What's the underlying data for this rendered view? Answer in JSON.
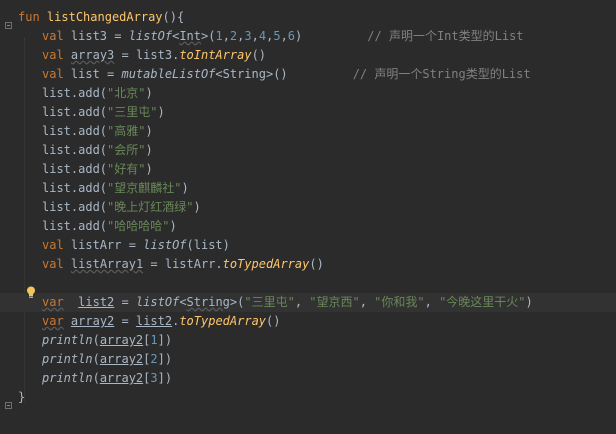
{
  "colors": {
    "background": "#2b2b2b",
    "keyword": "#cc7832",
    "function": "#ffc66d",
    "number": "#6897bb",
    "string": "#6a8759",
    "comment": "#808080",
    "text": "#a9b7c6"
  },
  "lines": [
    {
      "indent": 0,
      "tokens": [
        {
          "t": "fun",
          "c": "kw"
        },
        {
          "t": " "
        },
        {
          "t": "listChangedArray",
          "c": "fn"
        },
        {
          "t": "(){"
        }
      ]
    },
    {
      "indent": 1,
      "tokens": [
        {
          "t": "val",
          "c": "kw"
        },
        {
          "t": " list3 = "
        },
        {
          "t": "listOf",
          "c": "it"
        },
        {
          "t": "<"
        },
        {
          "t": "Int",
          "c": "und"
        },
        {
          "t": ">("
        },
        {
          "t": "1",
          "c": "num"
        },
        {
          "t": ","
        },
        {
          "t": "2",
          "c": "num"
        },
        {
          "t": ","
        },
        {
          "t": "3",
          "c": "num"
        },
        {
          "t": ","
        },
        {
          "t": "4",
          "c": "num"
        },
        {
          "t": ","
        },
        {
          "t": "5",
          "c": "num"
        },
        {
          "t": ","
        },
        {
          "t": "6",
          "c": "num"
        },
        {
          "t": ")         "
        },
        {
          "t": "// 声明一个Int类型的List",
          "c": "cmt"
        }
      ]
    },
    {
      "indent": 1,
      "tokens": [
        {
          "t": "val",
          "c": "kw"
        },
        {
          "t": " "
        },
        {
          "t": "array3",
          "c": "und"
        },
        {
          "t": " = list3."
        },
        {
          "t": "toIntArray",
          "c": "fn it"
        },
        {
          "t": "()"
        }
      ]
    },
    {
      "indent": 1,
      "tokens": [
        {
          "t": "val",
          "c": "kw"
        },
        {
          "t": " list = "
        },
        {
          "t": "mutableListOf",
          "c": "it"
        },
        {
          "t": "<String>()         "
        },
        {
          "t": "// 声明一个String类型的List",
          "c": "cmt"
        }
      ]
    },
    {
      "indent": 1,
      "tokens": [
        {
          "t": "list.add("
        },
        {
          "t": "\"北京\"",
          "c": "str"
        },
        {
          "t": ")"
        }
      ]
    },
    {
      "indent": 1,
      "tokens": [
        {
          "t": "list.add("
        },
        {
          "t": "\"三里屯\"",
          "c": "str"
        },
        {
          "t": ")"
        }
      ]
    },
    {
      "indent": 1,
      "tokens": [
        {
          "t": "list.add("
        },
        {
          "t": "\"高雅\"",
          "c": "str"
        },
        {
          "t": ")"
        }
      ]
    },
    {
      "indent": 1,
      "tokens": [
        {
          "t": "list.add("
        },
        {
          "t": "\"会所\"",
          "c": "str"
        },
        {
          "t": ")"
        }
      ]
    },
    {
      "indent": 1,
      "tokens": [
        {
          "t": "list.add("
        },
        {
          "t": "\"好有\"",
          "c": "str"
        },
        {
          "t": ")"
        }
      ]
    },
    {
      "indent": 1,
      "tokens": [
        {
          "t": "list.add("
        },
        {
          "t": "\"望京麒麟社\"",
          "c": "str"
        },
        {
          "t": ")"
        }
      ]
    },
    {
      "indent": 1,
      "tokens": [
        {
          "t": "list.add("
        },
        {
          "t": "\"晚上灯红酒绿\"",
          "c": "str"
        },
        {
          "t": ")"
        }
      ]
    },
    {
      "indent": 1,
      "tokens": [
        {
          "t": "list.add("
        },
        {
          "t": "\"哈哈哈哈\"",
          "c": "str"
        },
        {
          "t": ")"
        }
      ]
    },
    {
      "indent": 1,
      "tokens": [
        {
          "t": "val",
          "c": "kw"
        },
        {
          "t": " listArr = "
        },
        {
          "t": "listOf",
          "c": "it"
        },
        {
          "t": "(list)"
        }
      ]
    },
    {
      "indent": 1,
      "tokens": [
        {
          "t": "val",
          "c": "kw"
        },
        {
          "t": " "
        },
        {
          "t": "listArray1",
          "c": "und"
        },
        {
          "t": " = listArr."
        },
        {
          "t": "toTypedArray",
          "c": "fn it"
        },
        {
          "t": "()"
        }
      ]
    },
    {
      "indent": 1,
      "tokens": []
    },
    {
      "indent": 1,
      "current": true,
      "tokens": [
        {
          "t": "var",
          "c": "kw und"
        },
        {
          "t": "  "
        },
        {
          "t": "list2",
          "c": "uline"
        },
        {
          "t": " = "
        },
        {
          "t": "listOf",
          "c": "it"
        },
        {
          "t": "<"
        },
        {
          "t": "String",
          "c": "und"
        },
        {
          "t": ">("
        },
        {
          "t": "\"三里屯\"",
          "c": "str"
        },
        {
          "t": ", "
        },
        {
          "t": "\"望京西\"",
          "c": "str"
        },
        {
          "t": ", "
        },
        {
          "t": "\"你和我\"",
          "c": "str"
        },
        {
          "t": ", "
        },
        {
          "t": "\"今晚这里干火\"",
          "c": "str"
        },
        {
          "t": ")"
        }
      ]
    },
    {
      "indent": 1,
      "tokens": [
        {
          "t": "var",
          "c": "kw und"
        },
        {
          "t": " "
        },
        {
          "t": "array2",
          "c": "uline"
        },
        {
          "t": " = "
        },
        {
          "t": "list2",
          "c": "uline"
        },
        {
          "t": "."
        },
        {
          "t": "toTypedArray",
          "c": "fn it"
        },
        {
          "t": "()"
        }
      ]
    },
    {
      "indent": 1,
      "tokens": [
        {
          "t": "println",
          "c": "it"
        },
        {
          "t": "("
        },
        {
          "t": "array2",
          "c": "uline"
        },
        {
          "t": "["
        },
        {
          "t": "1",
          "c": "num"
        },
        {
          "t": "])"
        }
      ]
    },
    {
      "indent": 1,
      "tokens": [
        {
          "t": "println",
          "c": "it"
        },
        {
          "t": "("
        },
        {
          "t": "array2",
          "c": "uline"
        },
        {
          "t": "["
        },
        {
          "t": "2",
          "c": "num"
        },
        {
          "t": "])"
        }
      ]
    },
    {
      "indent": 1,
      "tokens": [
        {
          "t": "println",
          "c": "it"
        },
        {
          "t": "("
        },
        {
          "t": "array2",
          "c": "uline"
        },
        {
          "t": "["
        },
        {
          "t": "3",
          "c": "num"
        },
        {
          "t": "])"
        }
      ]
    },
    {
      "indent": 0,
      "tokens": [
        {
          "t": "}"
        }
      ]
    }
  ]
}
